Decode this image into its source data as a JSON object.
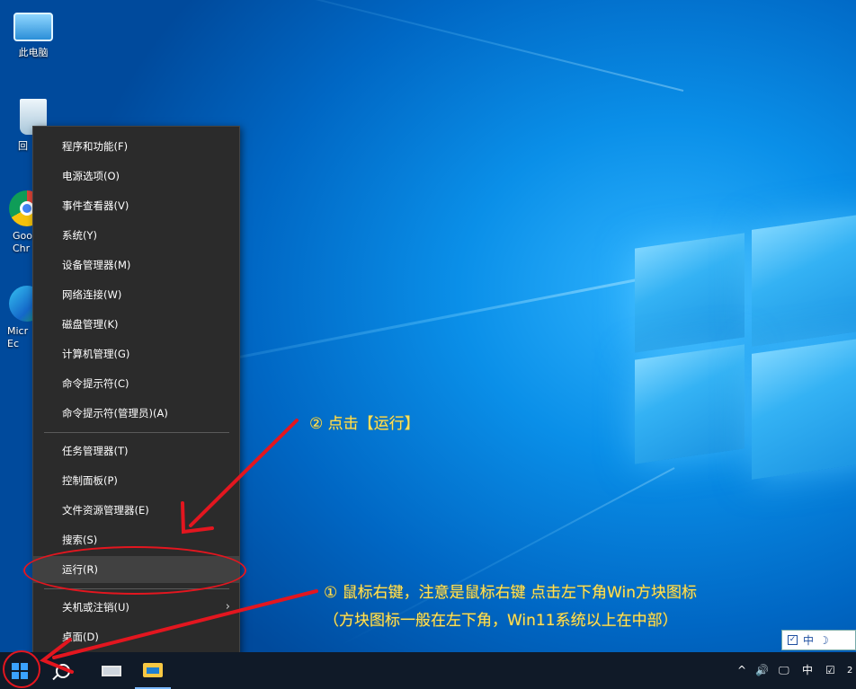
{
  "desktop": {
    "icons": [
      {
        "label": "此电脑",
        "icon": "this-pc-icon"
      },
      {
        "label": "回",
        "icon": "recycle-bin-icon"
      },
      {
        "label": "Goo Chr",
        "icon": "chrome-icon"
      },
      {
        "label": "Micr Ec",
        "icon": "edge-icon"
      }
    ]
  },
  "context_menu": {
    "items": [
      {
        "label": "程序和功能(F)"
      },
      {
        "label": "电源选项(O)"
      },
      {
        "label": "事件查看器(V)"
      },
      {
        "label": "系统(Y)"
      },
      {
        "label": "设备管理器(M)"
      },
      {
        "label": "网络连接(W)"
      },
      {
        "label": "磁盘管理(K)"
      },
      {
        "label": "计算机管理(G)"
      },
      {
        "label": "命令提示符(C)"
      },
      {
        "label": "命令提示符(管理员)(A)"
      },
      {
        "label": "任务管理器(T)"
      },
      {
        "label": "控制面板(P)"
      },
      {
        "label": "文件资源管理器(E)"
      },
      {
        "label": "搜索(S)"
      },
      {
        "label": "运行(R)"
      },
      {
        "label": "关机或注销(U)"
      },
      {
        "label": "桌面(D)"
      }
    ],
    "highlighted": "运行(R)"
  },
  "annotations": {
    "step1_line1": "① 鼠标右键，注意是鼠标右键 点击左下角Win方块图标",
    "step1_line2": "（方块图标一般在左下角，Win11系统以上在中部）",
    "step2": "② 点击【运行】",
    "color": "#e3161f",
    "text_color": "#ffe15a"
  },
  "taskbar": {
    "tray_chevron": "^",
    "volume": "🔊",
    "ime": "中",
    "clock_partial": "2"
  },
  "ime_bar": {
    "lang": "中",
    "mode": "☽"
  }
}
